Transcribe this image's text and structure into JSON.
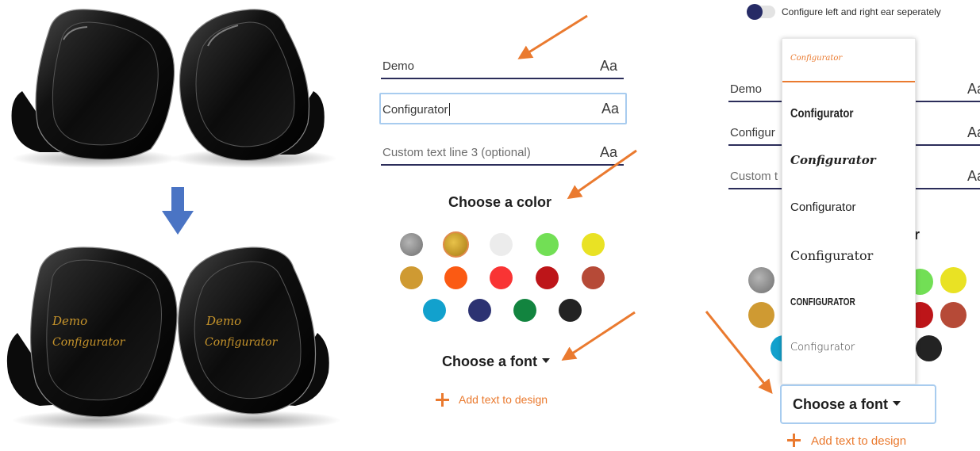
{
  "earbud_panel": {
    "engraving_line1": "Demo",
    "engraving_line2": "Configurator",
    "engraving_color": "#c8952b",
    "arrow_color": "#4a74c4"
  },
  "middle_panel": {
    "fields": [
      {
        "value": "Demo",
        "placeholder": "",
        "font_icon": "Aa"
      },
      {
        "value": "Configurator",
        "placeholder": "",
        "font_icon": "Aa"
      },
      {
        "value": "",
        "placeholder": "Custom text line 3 (optional)",
        "font_icon": "Aa"
      }
    ],
    "color_heading": "Choose a color",
    "font_heading": "Choose a font",
    "add_text": "Add text to design",
    "swatches": [
      {
        "name": "silver-glitter",
        "color": "#8c8c8c"
      },
      {
        "name": "gold-glitter",
        "color": "#c99a1e",
        "selected": true
      },
      {
        "name": "light-gray",
        "color": "#ececec"
      },
      {
        "name": "green",
        "color": "#72df55"
      },
      {
        "name": "yellow",
        "color": "#e9e224"
      },
      {
        "name": "ochre",
        "color": "#cf9a32"
      },
      {
        "name": "orange",
        "color": "#fb5a13"
      },
      {
        "name": "red",
        "color": "#f93434"
      },
      {
        "name": "dark-red",
        "color": "#bd1519"
      },
      {
        "name": "brick",
        "color": "#b64a37"
      },
      {
        "name": "cyan",
        "color": "#12a1cd"
      },
      {
        "name": "navy",
        "color": "#2c3272"
      },
      {
        "name": "dark-green",
        "color": "#12843f"
      },
      {
        "name": "black",
        "color": "#232323"
      }
    ]
  },
  "right_panel": {
    "toggle_label": "Configure left and right ear seperately",
    "fields": [
      {
        "value": "Demo",
        "font_icon": "Aa"
      },
      {
        "value": "Configur",
        "font_icon": "Aa"
      },
      {
        "value": "Custom t",
        "font_icon": "Aa"
      }
    ],
    "partial_heading_char": "r",
    "font_options": [
      "Configurator",
      "Configurator",
      "Configurator",
      "Configurator",
      "Configurator",
      "CONFIGURATOR",
      "Configurator"
    ],
    "font_button": "Choose a font",
    "add_text": "Add text to design",
    "swatches": [
      {
        "name": "silver-glitter",
        "color": "#8c8c8c"
      },
      {
        "name": "green",
        "color": "#72df55"
      },
      {
        "name": "yellow",
        "color": "#e9e224"
      },
      {
        "name": "ochre",
        "color": "#cf9a32"
      },
      {
        "name": "dark-red",
        "color": "#bd1519"
      },
      {
        "name": "brick",
        "color": "#b64a37"
      },
      {
        "name": "cyan",
        "color": "#12a1cd"
      },
      {
        "name": "black",
        "color": "#232323"
      }
    ]
  },
  "annotation_color": "#ea7a2f"
}
